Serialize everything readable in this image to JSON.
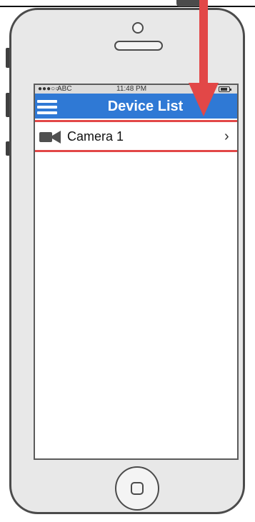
{
  "status_bar": {
    "signal_dots": "●●●○○",
    "carrier": "ABC",
    "time": "11:48 PM"
  },
  "nav_bar": {
    "title": "Device List",
    "menu_icon": "hamburger-menu-icon"
  },
  "devices": [
    {
      "label": "Camera 1",
      "icon": "video-camera-icon",
      "accessory": "chevron-right-icon"
    }
  ],
  "annotation": {
    "arrow_color": "#e24747",
    "highlight_color": "#e24747"
  },
  "colors": {
    "nav_blue": "#2f79d5",
    "phone_gray": "#e8e8e8"
  }
}
